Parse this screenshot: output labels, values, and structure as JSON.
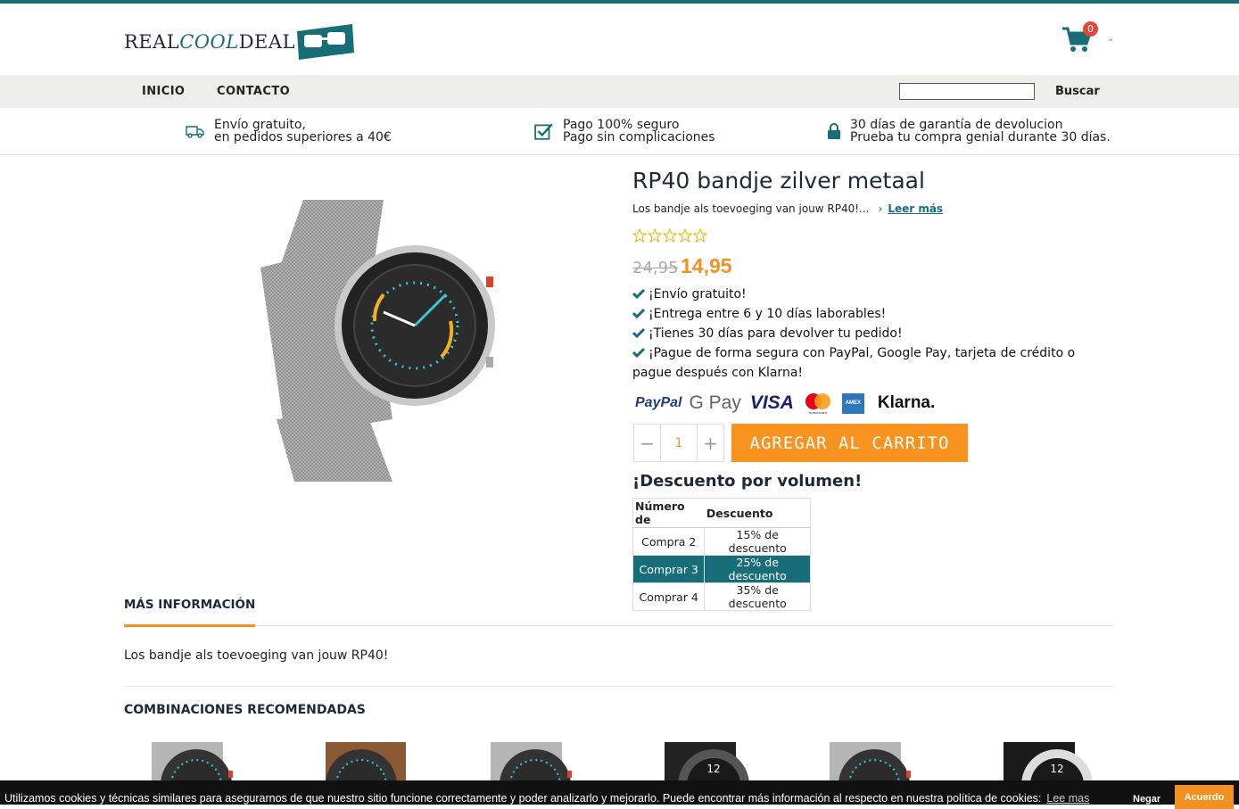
{
  "brand": {
    "logo_part1": "REAL",
    "logo_part2": "COOL",
    "logo_part3": "DEAL",
    "accent": "#176e78",
    "orange": "#f39020"
  },
  "cart": {
    "count": "0"
  },
  "nav": {
    "items": [
      "INICIO",
      "CONTACTO"
    ],
    "search_placeholder": "",
    "search_button": "Buscar"
  },
  "usp": [
    {
      "icon": "truck-icon",
      "line1": "Envío gratuito,",
      "line2": "en pedidos superiores a 40€"
    },
    {
      "icon": "checkbox-icon",
      "line1": "Pago 100% seguro",
      "line2": "Pago sin complicaciones"
    },
    {
      "icon": "lock-icon",
      "line1": "30 días de garantía de devolucion",
      "line2": "Prueba tu compra genial durante 30 días."
    }
  ],
  "product": {
    "title": "RP40 bandje zilver metaal",
    "summary": "Los bandje als toevoeging van jouw RP40!...",
    "read_more": "Leer más",
    "rating": 0,
    "price_old": "24,95",
    "price_new": "14,95",
    "benefits": [
      "¡Envío gratuito!",
      "¡Entrega entre 6 y 10 días laborables!",
      "¡Tienes 30 días para devolver tu pedido!",
      "¡Pague de forma segura con PayPal, Google Pay, tarjeta de crédito o pague después con Klarna!"
    ],
    "payment_methods": [
      "PayPal",
      "G Pay",
      "VISA",
      "mastercard",
      "AMEX",
      "Klarna."
    ],
    "quantity": "1",
    "qty_minus": "−",
    "qty_plus": "+",
    "add_to_cart": "AGREGAR AL CARRITO"
  },
  "volume": {
    "title": "¡Descuento por volumen!",
    "headers": [
      "Número de",
      "Descuento"
    ],
    "rows": [
      {
        "qty": "Compra 2",
        "discount": "15% de descuento"
      },
      {
        "qty": "Comprar 3",
        "discount": "25% de descuento"
      },
      {
        "qty": "Comprar 4",
        "discount": "35% de descuento"
      }
    ]
  },
  "tabs": {
    "active": "MÁS INFORMACIÓN"
  },
  "description": "Los bandje als toevoeging van jouw RP40!",
  "recommended": {
    "title": "COMBINACIONES RECOMENDADAS",
    "items": [
      "silver-mesh",
      "brown-leather",
      "silver-mesh",
      "black-mesh",
      "silver-mesh",
      "black-leather"
    ]
  },
  "cookie": {
    "text": "Utilizamos cookies y técnicas similares para asegurarnos de que nuestro sitio funcione correctamente y poder analizarlo y mejorarlo. Puede encontrar más información al respecto en nuestra política de cookies:",
    "link": "Lee mas",
    "deny": "Negar",
    "accept": "Acuerdo"
  }
}
